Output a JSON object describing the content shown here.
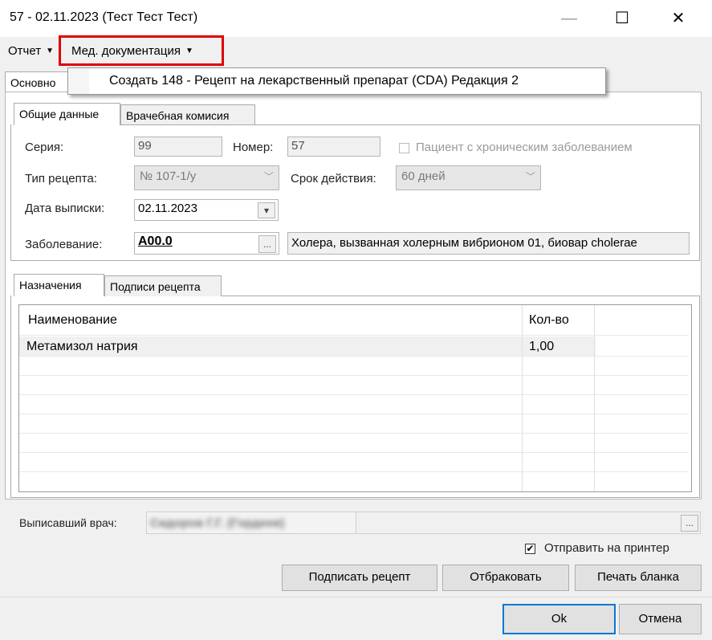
{
  "window": {
    "title": "57 - 02.11.2023 (Тест Тест Тест)",
    "minimize": "—",
    "maximize": "☐",
    "close": "✕"
  },
  "menu": {
    "report": "Отчет",
    "med_docs": "Мед. документация",
    "dropdown_item": "Создать 148 - Рецепт на лекарственный препарат (CDA) Редакция 2"
  },
  "main_tabs": {
    "basic": "Основно"
  },
  "sub_tabs": {
    "general": "Общие данные",
    "commission": "Врачебная комисия"
  },
  "form": {
    "series_label": "Серия:",
    "series_value": "99",
    "number_label": "Номер:",
    "number_value": "57",
    "chronic_label": "Пациент с хроническим заболеванием",
    "type_label": "Тип рецепта:",
    "type_value": "№ 107-1/у",
    "validity_label": "Срок действия:",
    "validity_value": "60 дней",
    "date_label": "Дата выписки:",
    "date_value": "02.11.2023",
    "disease_label": "Заболевание:",
    "disease_code": "A00.0",
    "disease_btn": "...",
    "disease_name": "Холера, вызванная холерным вибрионом 01, биовар cholerae"
  },
  "lower_tabs": {
    "prescriptions": "Назначения",
    "signatures": "Подписи рецепта"
  },
  "table": {
    "headers": [
      "Наименование",
      "Кол-во"
    ],
    "rows": [
      {
        "name": "Метамизол натрия",
        "qty": "1,00"
      }
    ]
  },
  "doctor": {
    "label": "Выписавший врач:",
    "value": "Сидоров Г.Г. (Гордеев)",
    "btn": "..."
  },
  "printer": {
    "label": "Отправить на принтер",
    "checked": "✔"
  },
  "buttons": {
    "sign": "Подписать рецепт",
    "reject": "Отбраковать",
    "print": "Печать бланка",
    "ok": "Ok",
    "cancel": "Отмена"
  }
}
